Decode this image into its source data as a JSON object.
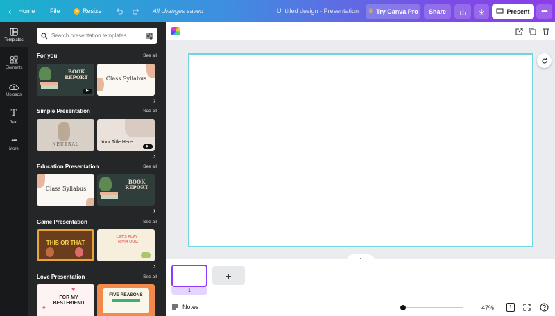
{
  "topbar": {
    "home": "Home",
    "file": "File",
    "resize": "Resize",
    "saved": "All changes saved",
    "doc_title": "Untitled design - Presentation",
    "try_pro": "Try Canva Pro",
    "share": "Share",
    "present": "Present"
  },
  "rail": {
    "items": [
      {
        "label": "Templates"
      },
      {
        "label": "Elements"
      },
      {
        "label": "Uploads"
      },
      {
        "label": "Text"
      },
      {
        "label": "More"
      }
    ]
  },
  "search": {
    "placeholder": "Search presentation templates"
  },
  "sections": [
    {
      "title": "For you",
      "see_all": "See all"
    },
    {
      "title": "Simple Presentation",
      "see_all": "See all"
    },
    {
      "title": "Education Presentation",
      "see_all": "See all"
    },
    {
      "title": "Game Presentation",
      "see_all": "See all"
    },
    {
      "title": "Love Presentation",
      "see_all": "See all"
    }
  ],
  "thumbs": {
    "book_report": "BOOK REPORT",
    "class_syllabus": "Class Syllabus",
    "neutral": "NEUTRAL",
    "your_title": "Your Title Here",
    "this_or_that": "THIS OR THAT",
    "trivia": "LET'S PLAY TRIVIA QUIZ",
    "bestfriend": "FOR MY BESTFRIEND",
    "five_reasons": "FIVE REASONS"
  },
  "footer": {
    "notes": "Notes",
    "zoom": "47%",
    "page_number": "1",
    "page_count_icon": "1"
  },
  "colors": {
    "accent": "#8b3dff",
    "page_border": "#6fd6e1"
  }
}
